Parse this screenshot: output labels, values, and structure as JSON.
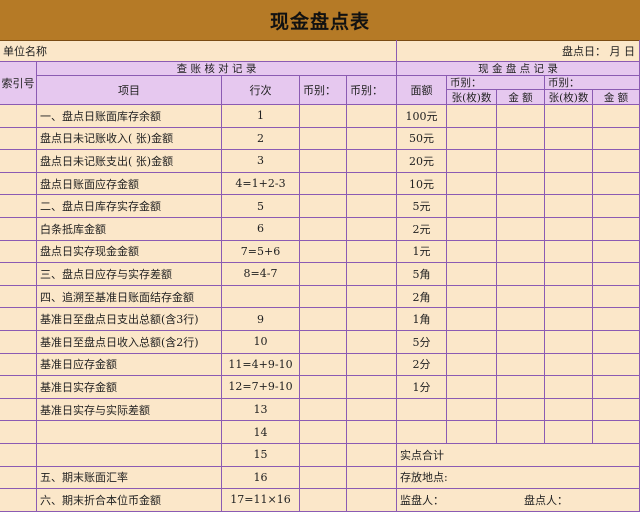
{
  "title": "现金盘点表",
  "unit_label": "单位名称",
  "count_date": "盘点日：     月     日",
  "index_label": "索引号",
  "check_section": "查 账 核 对 记 录",
  "cash_section": "现 金 盘 点 记 录",
  "col_item": "项目",
  "col_line": "行次",
  "col_currency1": "币别：",
  "col_currency2": "币别：",
  "col_denom": "面额",
  "cash_currency_a": "币别：",
  "cash_currency_b": "币别：",
  "sub_count": "张(枚)数",
  "sub_amount": "金  额",
  "rows": [
    {
      "item": "一、盘点日账面库存余额",
      "line": "1",
      "denom": "100元"
    },
    {
      "item": "盘点日未记账收入(    张)金额",
      "line": "2",
      "denom": "50元"
    },
    {
      "item": "盘点日未记账支出(    张)金额",
      "line": "3",
      "denom": "20元"
    },
    {
      "item": "盘点日账面应存金额",
      "line": "4=1+2-3",
      "denom": "10元"
    },
    {
      "item": "二、盘点日库存实存金额",
      "line": "5",
      "denom": "5元"
    },
    {
      "item": "白条抵库金额",
      "line": "6",
      "denom": "2元"
    },
    {
      "item": "盘点日实存现金金额",
      "line": "7=5+6",
      "denom": "1元"
    },
    {
      "item": "三、盘点日应存与实存差额",
      "line": "8=4-7",
      "denom": "5角"
    },
    {
      "item": "四、追溯至基准日账面结存金额",
      "line": "",
      "denom": "2角"
    },
    {
      "item": "基准日至盘点日支出总额(含3行)",
      "line": "9",
      "denom": "1角"
    },
    {
      "item": "基准日至盘点日收入总额(含2行)",
      "line": "10",
      "denom": "5分"
    },
    {
      "item": "基准日应存金额",
      "line": "11=4+9-10",
      "denom": "2分"
    },
    {
      "item": "基准日实存金额",
      "line": "12=7+9-10",
      "denom": "1分"
    },
    {
      "item": "基准日实存与实际差额",
      "line": "13",
      "denom": ""
    },
    {
      "item": "",
      "line": "14",
      "denom": ""
    },
    {
      "item": "",
      "line": "15",
      "denom": "实点合计"
    },
    {
      "item": "五、期末账面汇率",
      "line": "16",
      "denom": "存放地点:"
    },
    {
      "item": "六、期末折合本位币金额",
      "line": "17=11×16",
      "denom": "监盘人："
    }
  ],
  "footer_right": "盘点人："
}
